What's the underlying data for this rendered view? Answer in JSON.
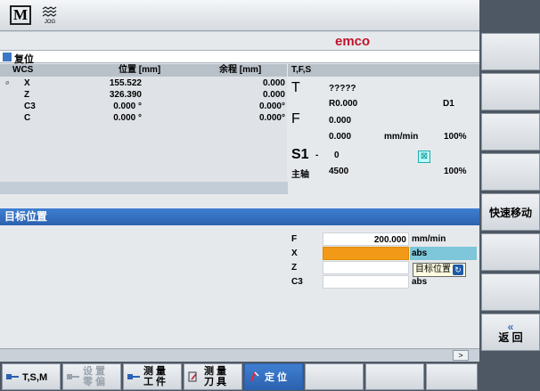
{
  "top": {
    "mode_m": "M",
    "mode_jog_sub": "JOG"
  },
  "brand": {
    "logo": "emco",
    "logo_color": "#c0142c"
  },
  "status": {
    "text": "复位"
  },
  "headers": {
    "wcs": "WCS",
    "position": "位置 [mm]",
    "dtg": "余程 [mm]",
    "tfs": "T,F,S"
  },
  "axes": [
    {
      "marker": "ø",
      "name": "X",
      "position": "155.522",
      "dtg": "0.000"
    },
    {
      "marker": "",
      "name": "Z",
      "position": "326.390",
      "dtg": "0.000"
    },
    {
      "marker": "",
      "name": "C3",
      "position": "0.000 °",
      "dtg": "0.000°"
    },
    {
      "marker": "",
      "name": "C",
      "position": "0.000 °",
      "dtg": "0.000°"
    }
  ],
  "tfs": {
    "t_letter": "T",
    "tool_name": "?????",
    "radius": "R0.000",
    "edge": "D1",
    "f_letter": "F",
    "feed_set": "0.000",
    "feed_act": "0.000",
    "feed_unit": "mm/min",
    "feed_pct": "100%",
    "spindle_label": "S1",
    "spindle_dir": "-",
    "spindle_set": "0",
    "spindle_name": "主轴",
    "spindle_act": "4500",
    "spindle_pct": "100%"
  },
  "target": {
    "title": "目标位置",
    "rows": [
      {
        "label": "F",
        "value": "200.000",
        "unit": "mm/min"
      },
      {
        "label": "X",
        "value": "",
        "unit": "abs"
      },
      {
        "label": "Z",
        "value": "",
        "unit": ""
      },
      {
        "label": "C3",
        "value": "",
        "unit": "abs"
      }
    ],
    "tooltip": "目标位置"
  },
  "right_softkeys": {
    "rapid": "快速移动",
    "back_arrow": "«",
    "back": "返 回"
  },
  "bottom_softkeys": {
    "tsm": "T,S,M",
    "set_line1": "设 置",
    "set_line2": "零 偏",
    "meas_line1": "测 量",
    "meas_line2": "工 件",
    "tool_line1": "测 量",
    "tool_line2": "刀 具",
    "position": "定 位"
  },
  "scroll": {
    "arrow": ">"
  }
}
